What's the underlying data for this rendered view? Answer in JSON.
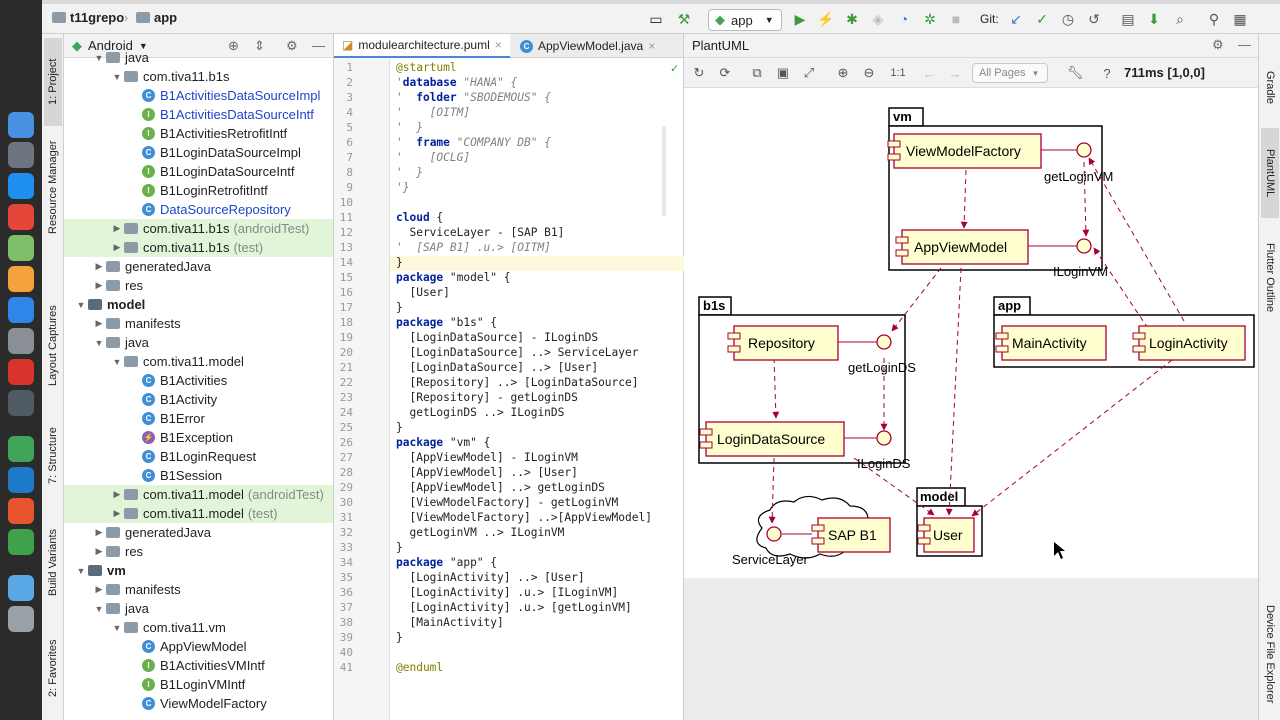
{
  "navbar": {
    "repo": "t11grepo",
    "module": "app",
    "run_config": "app",
    "git_label": "Git:"
  },
  "left_strip": {
    "tabs": [
      "1: Project",
      "Resource Manager",
      "Layout Captures",
      "7: Structure",
      "Build Variants",
      "2: Favorites"
    ]
  },
  "right_strip": {
    "tabs": [
      "Gradle",
      "PlantUML",
      "Flutter Outline",
      "Device File Explorer"
    ]
  },
  "project": {
    "view_selector": "Android",
    "tree": [
      {
        "label": "java",
        "suffix": "",
        "icon": "folder",
        "indent": 2,
        "arrow": "down",
        "color": "",
        "hl": false
      },
      {
        "label": "com.tiva11.b1s",
        "suffix": "",
        "icon": "package",
        "indent": 3,
        "arrow": "down",
        "color": "",
        "hl": false
      },
      {
        "label": "B1ActivitiesDataSourceImpl",
        "suffix": "",
        "icon": "class",
        "indent": 4,
        "arrow": "",
        "color": "blue",
        "hl": false
      },
      {
        "label": "B1ActivitiesDataSourceIntf",
        "suffix": "",
        "icon": "interface",
        "indent": 4,
        "arrow": "",
        "color": "blue",
        "hl": false
      },
      {
        "label": "B1ActivitiesRetrofitIntf",
        "suffix": "",
        "icon": "interface",
        "indent": 4,
        "arrow": "",
        "color": "",
        "hl": false
      },
      {
        "label": "B1LoginDataSourceImpl",
        "suffix": "",
        "icon": "class",
        "indent": 4,
        "arrow": "",
        "color": "",
        "hl": false
      },
      {
        "label": "B1LoginDataSourceIntf",
        "suffix": "",
        "icon": "interface",
        "indent": 4,
        "arrow": "",
        "color": "",
        "hl": false
      },
      {
        "label": "B1LoginRetrofitIntf",
        "suffix": "",
        "icon": "interface",
        "indent": 4,
        "arrow": "",
        "color": "",
        "hl": false
      },
      {
        "label": "DataSourceRepository",
        "suffix": "",
        "icon": "class",
        "indent": 4,
        "arrow": "",
        "color": "blue",
        "hl": false
      },
      {
        "label": "com.tiva11.b1s",
        "suffix": "(androidTest)",
        "icon": "package",
        "indent": 3,
        "arrow": "right",
        "color": "",
        "hl": true
      },
      {
        "label": "com.tiva11.b1s",
        "suffix": "(test)",
        "icon": "package",
        "indent": 3,
        "arrow": "right",
        "color": "",
        "hl": true
      },
      {
        "label": "generatedJava",
        "suffix": "",
        "icon": "folder",
        "indent": 2,
        "arrow": "right",
        "color": "",
        "hl": false
      },
      {
        "label": "res",
        "suffix": "",
        "icon": "folder",
        "indent": 2,
        "arrow": "right",
        "color": "",
        "hl": false
      },
      {
        "label": "model",
        "suffix": "",
        "icon": "module",
        "indent": 1,
        "arrow": "down",
        "color": "",
        "hl": false,
        "bold": true
      },
      {
        "label": "manifests",
        "suffix": "",
        "icon": "folder",
        "indent": 2,
        "arrow": "right",
        "color": "",
        "hl": false
      },
      {
        "label": "java",
        "suffix": "",
        "icon": "folder",
        "indent": 2,
        "arrow": "down",
        "color": "",
        "hl": false
      },
      {
        "label": "com.tiva11.model",
        "suffix": "",
        "icon": "package",
        "indent": 3,
        "arrow": "down",
        "color": "",
        "hl": false
      },
      {
        "label": "B1Activities",
        "suffix": "",
        "icon": "class",
        "indent": 4,
        "arrow": "",
        "color": "",
        "hl": false
      },
      {
        "label": "B1Activity",
        "suffix": "",
        "icon": "class",
        "indent": 4,
        "arrow": "",
        "color": "",
        "hl": false
      },
      {
        "label": "B1Error",
        "suffix": "",
        "icon": "class",
        "indent": 4,
        "arrow": "",
        "color": "",
        "hl": false
      },
      {
        "label": "B1Exception",
        "suffix": "",
        "icon": "exception",
        "indent": 4,
        "arrow": "",
        "color": "",
        "hl": false
      },
      {
        "label": "B1LoginRequest",
        "suffix": "",
        "icon": "class",
        "indent": 4,
        "arrow": "",
        "color": "",
        "hl": false
      },
      {
        "label": "B1Session",
        "suffix": "",
        "icon": "class",
        "indent": 4,
        "arrow": "",
        "color": "",
        "hl": false
      },
      {
        "label": "com.tiva11.model",
        "suffix": "(androidTest)",
        "icon": "package",
        "indent": 3,
        "arrow": "right",
        "color": "",
        "hl": true
      },
      {
        "label": "com.tiva11.model",
        "suffix": "(test)",
        "icon": "package",
        "indent": 3,
        "arrow": "right",
        "color": "",
        "hl": true
      },
      {
        "label": "generatedJava",
        "suffix": "",
        "icon": "folder",
        "indent": 2,
        "arrow": "right",
        "color": "",
        "hl": false
      },
      {
        "label": "res",
        "suffix": "",
        "icon": "folder",
        "indent": 2,
        "arrow": "right",
        "color": "",
        "hl": false
      },
      {
        "label": "vm",
        "suffix": "",
        "icon": "module",
        "indent": 1,
        "arrow": "down",
        "color": "",
        "hl": false,
        "bold": true
      },
      {
        "label": "manifests",
        "suffix": "",
        "icon": "folder",
        "indent": 2,
        "arrow": "right",
        "color": "",
        "hl": false
      },
      {
        "label": "java",
        "suffix": "",
        "icon": "folder",
        "indent": 2,
        "arrow": "down",
        "color": "",
        "hl": false
      },
      {
        "label": "com.tiva11.vm",
        "suffix": "",
        "icon": "package",
        "indent": 3,
        "arrow": "down",
        "color": "",
        "hl": false
      },
      {
        "label": "AppViewModel",
        "suffix": "",
        "icon": "class",
        "indent": 4,
        "arrow": "",
        "color": "",
        "hl": false
      },
      {
        "label": "B1ActivitiesVMIntf",
        "suffix": "",
        "icon": "interface",
        "indent": 4,
        "arrow": "",
        "color": "",
        "hl": false
      },
      {
        "label": "B1LoginVMIntf",
        "suffix": "",
        "icon": "interface",
        "indent": 4,
        "arrow": "",
        "color": "",
        "hl": false
      },
      {
        "label": "ViewModelFactory",
        "suffix": "",
        "icon": "class",
        "indent": 4,
        "arrow": "",
        "color": "",
        "hl": false
      }
    ]
  },
  "editor": {
    "tabs": [
      {
        "label": "modulearchitecture.puml",
        "active": true
      },
      {
        "label": "AppViewModel.java",
        "active": false
      }
    ],
    "lines": [
      {
        "n": "1",
        "html": "<span class=\"ann\">@startuml</span>"
      },
      {
        "n": "2",
        "html": "<span class=\"cm\">'</span><span class=\"kw\">database</span> <span class=\"cm\">\"HANA\" {</span>"
      },
      {
        "n": "3",
        "html": "<span class=\"cm\">'  </span><span class=\"kw\">folder</span> <span class=\"cm\">\"SBODEMOUS\" {</span>"
      },
      {
        "n": "4",
        "html": "<span class=\"cm\">'    [OITM]</span>"
      },
      {
        "n": "5",
        "html": "<span class=\"cm\">'  }</span>"
      },
      {
        "n": "6",
        "html": "<span class=\"cm\">'  </span><span class=\"kw\">frame</span> <span class=\"cm\">\"COMPANY DB\" {</span>"
      },
      {
        "n": "7",
        "html": "<span class=\"cm\">'    [OCLG]</span>"
      },
      {
        "n": "8",
        "html": "<span class=\"cm\">'  }</span>"
      },
      {
        "n": "9",
        "html": "<span class=\"cm\">'}</span>"
      },
      {
        "n": "10",
        "html": ""
      },
      {
        "n": "11",
        "html": "<span class=\"kw\">cloud</span> {"
      },
      {
        "n": "12",
        "html": "  ServiceLayer - [SAP B1]"
      },
      {
        "n": "13",
        "html": "<span class=\"cm\">'  [SAP B1] .u.> [OITM]</span>"
      },
      {
        "n": "14",
        "html": "}"
      },
      {
        "n": "15",
        "html": "<span class=\"kw\">package</span> \"model\" {"
      },
      {
        "n": "16",
        "html": "  [User]"
      },
      {
        "n": "17",
        "html": "}"
      },
      {
        "n": "18",
        "html": "<span class=\"kw\">package</span> \"b1s\" {"
      },
      {
        "n": "19",
        "html": "  [LoginDataSource] - ILoginDS"
      },
      {
        "n": "20",
        "html": "  [LoginDataSource] ..> ServiceLayer"
      },
      {
        "n": "21",
        "html": "  [LoginDataSource] ..> [User]"
      },
      {
        "n": "22",
        "html": "  [Repository] ..> [LoginDataSource]"
      },
      {
        "n": "23",
        "html": "  [Repository] - getLoginDS"
      },
      {
        "n": "24",
        "html": "  getLoginDS ..> ILoginDS"
      },
      {
        "n": "25",
        "html": "}"
      },
      {
        "n": "26",
        "html": "<span class=\"kw\">package</span> \"vm\" {"
      },
      {
        "n": "27",
        "html": "  [AppViewModel] - ILoginVM"
      },
      {
        "n": "28",
        "html": "  [AppViewModel] ..> [User]"
      },
      {
        "n": "29",
        "html": "  [AppViewModel] ..> getLoginDS"
      },
      {
        "n": "30",
        "html": "  [ViewModelFactory] - getLoginVM"
      },
      {
        "n": "31",
        "html": "  [ViewModelFactory] ..>[AppViewModel]"
      },
      {
        "n": "32",
        "html": "  getLoginVM ..> ILoginVM"
      },
      {
        "n": "33",
        "html": "}"
      },
      {
        "n": "34",
        "html": "<span class=\"kw\">package</span> \"app\" {"
      },
      {
        "n": "35",
        "html": "  [LoginActivity] ..> [User]"
      },
      {
        "n": "36",
        "html": "  [LoginActivity] .u.> [ILoginVM]"
      },
      {
        "n": "37",
        "html": "  [LoginActivity] .u.> [getLoginVM]"
      },
      {
        "n": "38",
        "html": "  [MainActivity]"
      },
      {
        "n": "39",
        "html": "}"
      },
      {
        "n": "40",
        "html": ""
      },
      {
        "n": "41",
        "html": "<span class=\"ann\">@enduml</span>"
      }
    ]
  },
  "plantuml": {
    "title": "PlantUML",
    "pages_select": "All Pages",
    "zoom_label": "1:1",
    "status": "711ms [1,0,0]",
    "diagram": {
      "pkg_vm": "vm",
      "pkg_b1s": "b1s",
      "pkg_app": "app",
      "pkg_model": "model",
      "c_vmfactory": "ViewModelFactory",
      "c_appvm": "AppViewModel",
      "c_repo": "Repository",
      "c_lds": "LoginDataSource",
      "c_main": "MainActivity",
      "c_login": "LoginActivity",
      "c_user": "User",
      "c_sap": "SAP B1",
      "i_getloginvm": "getLoginVM",
      "i_iloginvm": "ILoginVM",
      "i_getloginds": "getLoginDS",
      "i_iloginds": "ILoginDS",
      "i_servicelayer": "ServiceLayer"
    }
  }
}
